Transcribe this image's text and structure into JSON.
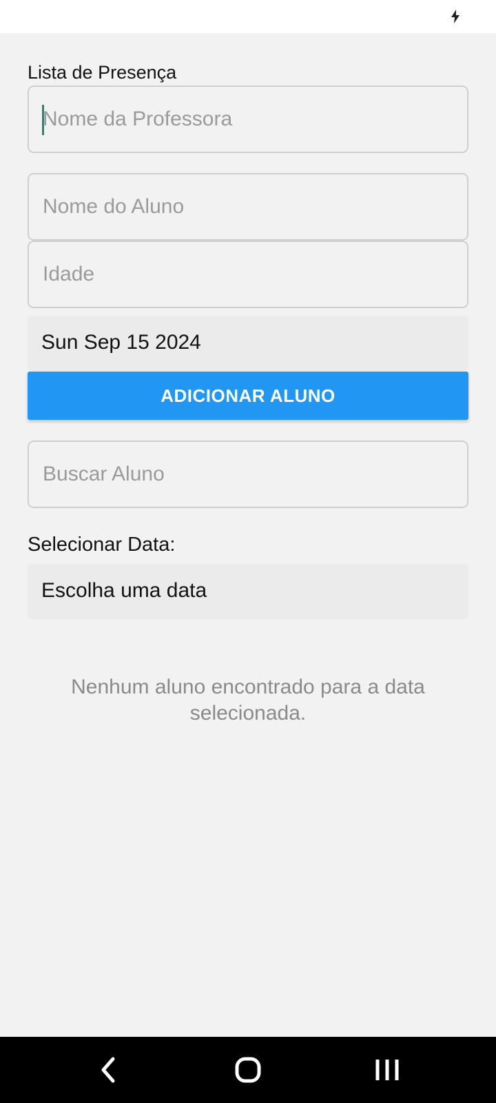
{
  "form": {
    "title": "Lista de Presença",
    "teacher_placeholder": "Nome da Professora",
    "student_placeholder": "Nome do Aluno",
    "age_placeholder": "Idade",
    "date_value": "Sun Sep 15 2024",
    "add_button_label": "ADICIONAR ALUNO"
  },
  "search": {
    "placeholder": "Buscar Aluno"
  },
  "filter": {
    "label": "Selecionar Data:",
    "date_picker_label": "Escolha uma data"
  },
  "list": {
    "empty_message": "Nenhum aluno encontrado para a data selecionada."
  },
  "status_bar": {
    "icons": [
      "charging-icon"
    ]
  },
  "nav_bar": {
    "icons": [
      "back-icon",
      "home-icon",
      "recents-icon"
    ]
  },
  "colors": {
    "accent": "#2196f3",
    "background": "#f2f2f2",
    "cursor": "#1a8a7a"
  }
}
